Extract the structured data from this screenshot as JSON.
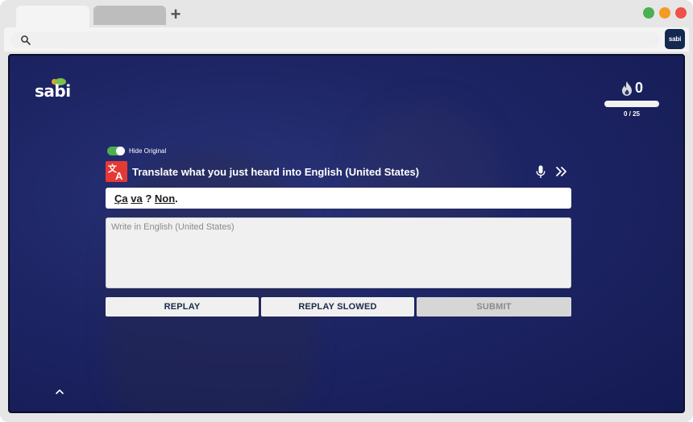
{
  "browser": {
    "new_tab_glyph": "+",
    "extension_badge": "sabi"
  },
  "app": {
    "logo_text": "sabi",
    "streak_count": "0",
    "progress": {
      "current": 0,
      "total": 25,
      "text": "0 / 25"
    },
    "toggle": {
      "label": "Hide Original",
      "on": true
    },
    "instruction": "Translate what you just heard into English (United States)",
    "sentence": {
      "words": [
        "Ça",
        "va",
        "Non"
      ],
      "separators": [
        " ",
        " ? ",
        "."
      ]
    },
    "answer": {
      "placeholder": "Write in English (United States)",
      "value": ""
    },
    "buttons": {
      "replay": "REPLAY",
      "replay_slowed": "REPLAY SLOWED",
      "submit": "SUBMIT"
    }
  },
  "colors": {
    "accent_green": "#4caf50",
    "translate_red": "#e53935",
    "background_navy": "#1d2565"
  },
  "icons": [
    "search-icon",
    "flame-icon",
    "translate-icon",
    "microphone-icon",
    "skip-icon",
    "chevron-up-icon"
  ]
}
